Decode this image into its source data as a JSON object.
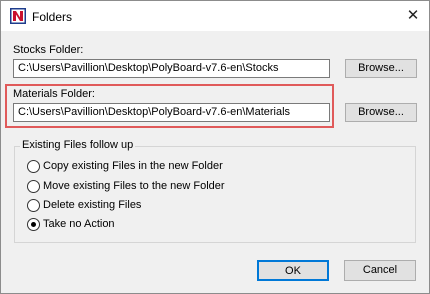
{
  "window": {
    "title": "Folders",
    "close_glyph": "✕"
  },
  "stocks": {
    "label": "Stocks Folder:",
    "value": "C:\\Users\\Pavillion\\Desktop\\PolyBoard-v7.6-en\\Stocks",
    "browse_label": "Browse..."
  },
  "materials": {
    "label": "Materials Folder:",
    "value": "C:\\Users\\Pavillion\\Desktop\\PolyBoard-v7.6-en\\Materials",
    "browse_label": "Browse..."
  },
  "existing_files": {
    "group_title": "Existing Files follow up",
    "options": [
      {
        "label": "Copy existing Files in the new Folder",
        "selected": false
      },
      {
        "label": "Move existing Files to the new Folder",
        "selected": false
      },
      {
        "label": "Delete existing Files",
        "selected": false
      },
      {
        "label": "Take no Action",
        "selected": true
      }
    ]
  },
  "footer": {
    "ok_label": "OK",
    "cancel_label": "Cancel"
  },
  "colors": {
    "highlight": "#e05a5a",
    "ok_border": "#0078d7",
    "app_icon_red": "#c8102e",
    "app_icon_blue": "#1e3c8c"
  },
  "icons": {
    "app": "polyboard-app-icon",
    "close": "close-icon"
  }
}
